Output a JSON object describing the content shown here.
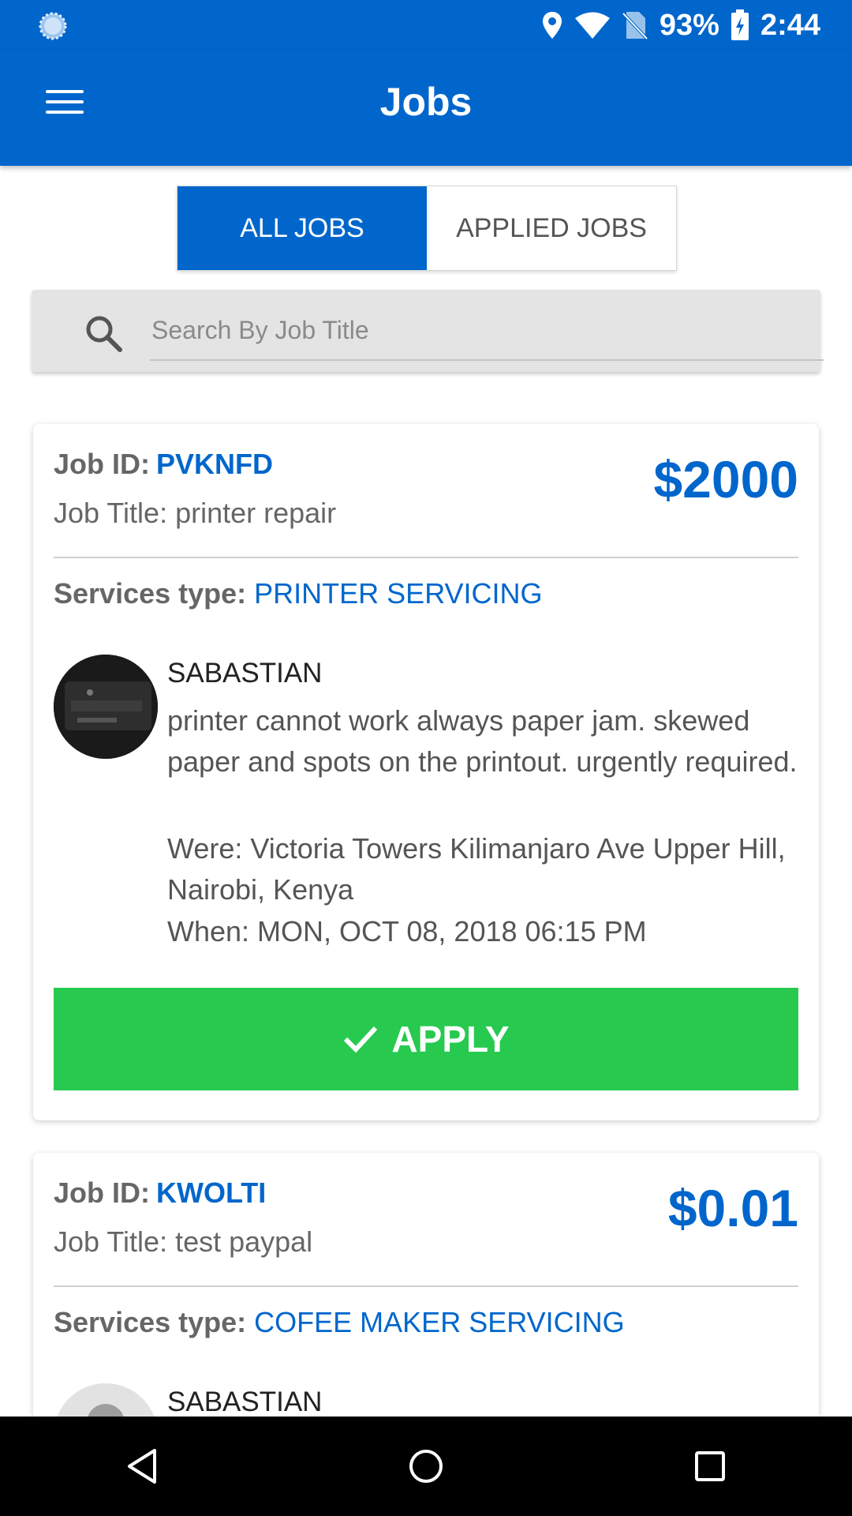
{
  "status_bar": {
    "battery": "93%",
    "time": "2:44",
    "icons": [
      "sync-icon",
      "location-icon",
      "wifi-icon",
      "no-sim-icon",
      "battery-charging-icon"
    ]
  },
  "app_bar": {
    "title": "Jobs",
    "menu_icon": "menu-icon"
  },
  "tabs": {
    "all_jobs": "ALL JOBS",
    "applied_jobs": "APPLIED JOBS",
    "active": "all_jobs"
  },
  "search": {
    "placeholder": "Search By Job Title",
    "value": ""
  },
  "labels": {
    "job_id": "Job ID:",
    "services_type": "Services type:"
  },
  "jobs": [
    {
      "id": "PVKNFD",
      "title": "Job Title: printer repair",
      "price": "$2000",
      "service": "PRINTER SERVICING",
      "poster": "SABASTIAN",
      "description": "printer cannot work always paper jam. skewed paper and spots on the printout. urgently required.",
      "where": "Were: Victoria Towers Kilimanjaro Ave Upper Hill, Nairobi, Kenya",
      "when": "When: MON, OCT 08, 2018 06:15 PM",
      "apply_label": "APPLY"
    },
    {
      "id": "KWOLTI",
      "title": "Job Title: test paypal",
      "price": "$0.01",
      "service": "COFEE MAKER SERVICING",
      "poster": "SABASTIAN"
    }
  ],
  "colors": {
    "primary": "#0066cc",
    "apply": "#27ca4f"
  },
  "nav": {
    "icons": [
      "back-icon",
      "home-icon",
      "recents-icon"
    ]
  }
}
